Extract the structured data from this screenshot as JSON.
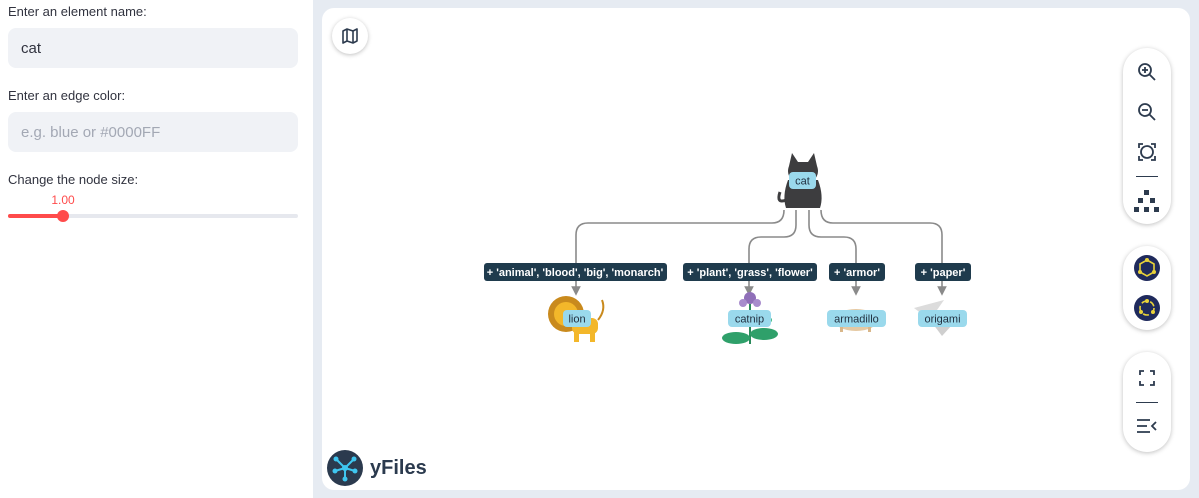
{
  "sidebar": {
    "element_name_label": "Enter an element name:",
    "element_name_value": "cat",
    "edge_color_label": "Enter an edge color:",
    "edge_color_placeholder": "e.g. blue or #0000FF",
    "node_size_label": "Change the node size:",
    "node_size_value": "1.00",
    "node_size_fraction": 0.19
  },
  "graph": {
    "root": {
      "label": "cat"
    },
    "edges": [
      {
        "label": "+ 'animal', 'blood', 'big', 'monarch'",
        "target": "lion"
      },
      {
        "label": "+ 'plant', 'grass', 'flower'",
        "target": "catnip"
      },
      {
        "label": "+ 'armor'",
        "target": "armadillo"
      },
      {
        "label": "+ 'paper'",
        "target": "origami"
      }
    ],
    "colors": {
      "edge": "#8a8a8a",
      "edge_label_bg": "#1f3b4d",
      "node_label_bg": "#9ad9ec"
    }
  },
  "toolbar": {
    "items": [
      "map-icon",
      "zoom-in-icon",
      "zoom-out-icon",
      "fit-content-icon",
      "hierarchic-layout-icon",
      "radial-layout-icon",
      "circular-layout-icon",
      "fullscreen-icon",
      "sidebar-toggle-icon"
    ]
  },
  "brand": {
    "text": "yFiles"
  },
  "accent": "#ff4b4b"
}
